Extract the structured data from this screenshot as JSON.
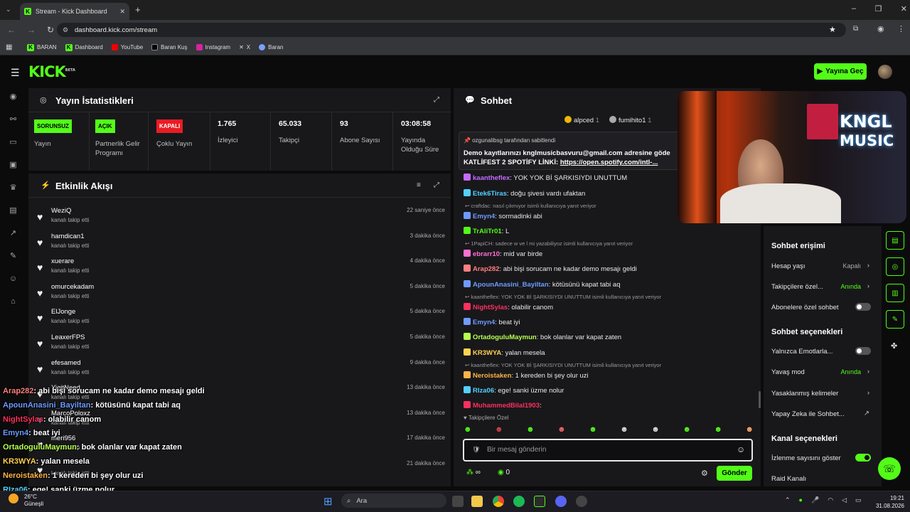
{
  "browser": {
    "tab_title": "Stream - Kick Dashboard",
    "url": "dashboard.kick.com/stream",
    "bookmarks": [
      "BARAN",
      "Dashboard",
      "YouTube",
      "Baran Kuş",
      "Instagram",
      "X",
      "Baran"
    ]
  },
  "header": {
    "logo": "KICK",
    "beta": "BETA",
    "go_live": "Yayına Geç"
  },
  "stats": {
    "title": "Yayın İstatistikleri",
    "items": [
      {
        "badge": "SORUNSUZ",
        "label": "Yayın"
      },
      {
        "badge": "AÇIK",
        "label": "Partnerlik Gelir Programı"
      },
      {
        "badge": "KAPALI",
        "label": "Çoklu Yayın"
      },
      {
        "value": "1.765",
        "label": "İzleyici"
      },
      {
        "value": "65.033",
        "label": "Takipçi"
      },
      {
        "value": "93",
        "label": "Abone Sayısı"
      },
      {
        "value": "03:08:58",
        "label": "Yayında Olduğu Süre"
      }
    ]
  },
  "activity": {
    "title": "Etkinlik Akışı",
    "items": [
      {
        "name": "WeziQ",
        "action": "kanalı takip etti",
        "time": "22 saniye önce"
      },
      {
        "name": "hamdican1",
        "action": "kanalı takip etti",
        "time": "3 dakika önce"
      },
      {
        "name": "xuerare",
        "action": "kanalı takip etti",
        "time": "4 dakika önce"
      },
      {
        "name": "omurcekadam",
        "action": "kanalı takip etti",
        "time": "5 dakika önce"
      },
      {
        "name": "ElJonge",
        "action": "kanalı takip etti",
        "time": "5 dakika önce"
      },
      {
        "name": "LeaxerFPS",
        "action": "kanalı takip etti",
        "time": "5 dakika önce"
      },
      {
        "name": "efesamed",
        "action": "kanalı takip etti",
        "time": "9 dakika önce"
      },
      {
        "name": "YigitNeed",
        "action": "kanalı takip etti",
        "time": "13 dakika önce"
      },
      {
        "name": "MarcoPoloxz",
        "action": "kanalı takip etti",
        "time": "13 dakika önce"
      },
      {
        "name": "meri956",
        "action": "kanalı takip etti",
        "time": "17 dakika önce"
      },
      {
        "name": "",
        "action": "kanalı takip etti",
        "time": "21 dakika önce"
      }
    ]
  },
  "chat": {
    "title": "Sohbet",
    "top_users": [
      {
        "name": "alpced",
        "count": "1"
      },
      {
        "name": "fumihito1",
        "count": "1"
      }
    ],
    "pinned": {
      "by": "ozgunalibsg tarafından sabitlendi",
      "line1": "Demo kayıtlarınızı knglmusicbasvuru@gmail.com adresine göde",
      "line2_prefix": "KATLİFEST 2 SPOTİFY LİNKİ: ",
      "line2_link": "https://open.spotify.com/intl-..."
    },
    "messages": [
      {
        "user": "kaantheflex",
        "color": "#c46bff",
        "text": ": YOK YOK Bİ ŞARKISIYDI UNUTTUM"
      },
      {
        "user": "Etek6Tiras",
        "color": "#53d0ff",
        "text": ": doğu şivesi vardı ufaktan"
      },
      {
        "reply": "craftdac: nasıl çıkmıyor isimli kullanıcıya yanıt veriyor"
      },
      {
        "user": "Emyn4",
        "color": "#6e9bff",
        "text": ": sormadinki abi"
      },
      {
        "user": "TrAliTr01",
        "color": "#53fc18",
        "text": ": L"
      },
      {
        "reply": "1PapiCH: sadece w ve l mi yazabiliyoz isimli kullanıcıya yanıt veriyor"
      },
      {
        "user": "ebrarr10",
        "color": "#ff6fd0",
        "text": ": mid var birde"
      },
      {
        "user": "Arap282",
        "color": "#ff7f7f",
        "text": ": abi bişi sorucam ne kadar demo mesajı geldi"
      },
      {
        "user": "ApounAnasini_Bayiltan",
        "color": "#6e9bff",
        "text": ": kötüsünü kapat tabi aq"
      },
      {
        "reply": "kaantheflex: YOK YOK Bİ ŞARKISIYDI UNUTTUM isimli kullanıcıya yanıt veriyor"
      },
      {
        "user": "NightSylas",
        "color": "#ff2f5f",
        "text": ": olabilir canom"
      },
      {
        "user": "Emyn4",
        "color": "#6e9bff",
        "text": ": beat iyi"
      },
      {
        "user": "OrtadoguluMaymun",
        "color": "#b6ff4f",
        "text": ": bok olanlar var kapat zaten"
      },
      {
        "user": "KR3WYA",
        "color": "#ffd24f",
        "text": ": yalan mesela"
      },
      {
        "reply": "kaantheflex: YOK YOK Bİ ŞARKISIYDI UNUTTUM isimli kullanıcıya yanıt veriyor"
      },
      {
        "user": "Neroistaken",
        "color": "#ffb347",
        "text": ": 1 kereden bi şey olur uzi"
      },
      {
        "user": "RIza06",
        "color": "#53d0ff",
        "text": ": ege! sanki üzme nolur"
      },
      {
        "user": "MuhammedBilal1903",
        "color": "#ff2f5f",
        "text": ":"
      }
    ],
    "followers_only": "Takipçilere Özel",
    "input_placeholder": "Bir mesaj gönderin",
    "count": "0",
    "send": "Gönder"
  },
  "overlay_chat": [
    {
      "user": "Arap282",
      "color": "#ff7f7f",
      "text": ": abi bişi sorucam ne kadar demo mesajı geldi"
    },
    {
      "user": "ApounAnasini_Bayiltan",
      "color": "#6e9bff",
      "text": ": kötüsünü kapat tabi aq"
    },
    {
      "user": "NightSylas",
      "color": "#ff2f5f",
      "text": ": olabilir canom"
    },
    {
      "user": "Emyn4",
      "color": "#6e9bff",
      "text": ": beat iyi"
    },
    {
      "user": "OrtadoguluMaymun",
      "color": "#b6ff4f",
      "text": ": bok olanlar var kapat zaten"
    },
    {
      "user": "KR3WYA",
      "color": "#ffd24f",
      "text": ": yalan mesela"
    },
    {
      "user": "Neroistaken",
      "color": "#ffb347",
      "text": ": 1 kereden bi şey olur uzi"
    },
    {
      "user": "RIza06",
      "color": "#53d0ff",
      "text": ": ege! sanki üzme nolur"
    }
  ],
  "settings": {
    "access_title": "Sohbet erişimi",
    "account_age": {
      "label": "Hesap yaşı",
      "value": "Kapalı"
    },
    "followers_only": {
      "label": "Takipçilere özel...",
      "value": "Anında"
    },
    "subs_only": {
      "label": "Abonelere özel sohbet"
    },
    "options_title": "Sohbet seçenekleri",
    "emotes_only": {
      "label": "Yalnızca Emotlarla..."
    },
    "slow_mode": {
      "label": "Yavaş mod",
      "value": "Anında"
    },
    "banned_words": {
      "label": "Yasaklanmış kelimeler"
    },
    "ai": {
      "label": "Yapay Zeka ile Sohbet..."
    },
    "channel_title": "Kanal seçenekleri",
    "show_views": {
      "label": "İzlenme sayısını göster"
    },
    "raid": {
      "label": "Raid Kanalı"
    }
  },
  "webcam": {
    "sign_line1": "KNGL",
    "sign_line2": "MUSIC"
  },
  "taskbar": {
    "weather_temp": "26°C",
    "weather_place": "Güneşli",
    "search": "Ara",
    "time": "19:21",
    "date": "31.08.2026"
  },
  "colors": {
    "kick_green": "#53fc18",
    "panel": "#18181b"
  }
}
